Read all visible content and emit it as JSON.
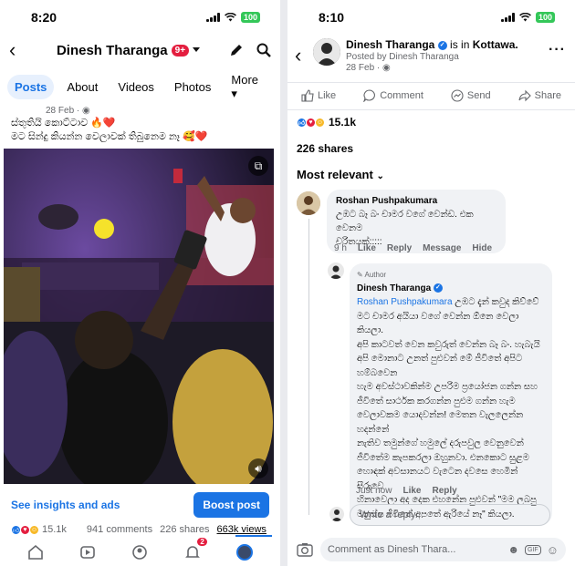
{
  "left": {
    "status": {
      "time": "8:20",
      "battery": "100"
    },
    "header": {
      "title": "Dinesh Tharanga",
      "badge": "9+"
    },
    "tabs": [
      "Posts",
      "About",
      "Videos",
      "Photos",
      "More"
    ],
    "post": {
      "time": "28 Feb · ",
      "line1": "ස්තුතියි කොට්ටාව 🔥❤️",
      "line2": "මට සින්දු කියන්න වෙලාවක් තිබුනෙම නෑ 🥰❤️"
    },
    "insights_link": "See insights and ads",
    "boost_label": "Boost post",
    "stats": {
      "reactions": "15.1k",
      "comments": "941 comments",
      "shares": "226 shares",
      "views": "663k views"
    },
    "nav_notification_badge": "2",
    "colors": {
      "accent": "#1b74e4",
      "badge": "#e41e3f"
    }
  },
  "right": {
    "status": {
      "time": "8:10",
      "battery": "100"
    },
    "header": {
      "name": "Dinesh Tharanga",
      "is_in": "is in",
      "place": "Kottawa.",
      "posted_by": "Posted by Dinesh Tharanga",
      "time": "28 Feb · "
    },
    "actions": [
      "Like",
      "Comment",
      "Send",
      "Share"
    ],
    "reactions": "15.1k",
    "shares": "226 shares",
    "sort": "Most relevant",
    "comment1": {
      "name": "Roshan Pushpakumara",
      "text_l1": "උඹට බෑ බං චාමර වගේ වෙන්ඩ. එක වෙනම",
      "text_l2": "චරිතයක්:::::",
      "time": "9 h",
      "like": "Like",
      "reply": "Reply",
      "message": "Message",
      "hide": "Hide"
    },
    "reply1": {
      "author_tag": "Author",
      "name": "Dinesh Tharanga",
      "mention": "Roshan Pushpakumara",
      "lines": [
        "උඹට දැන් කවුද කිව්වේ",
        "මට චාමර අයියා වගේ වෙන්න ඕනෙ වෙලා කියලා.",
        "අපි කාටවත් වෙන කවුරුත් වෙන්න බෑ බං. හැබැයි",
        "අපි මොනාට උනත් පුළුවන් මේ ජීවිතේ අපිට හම්බවෙන",
        "හැම අවස්ථාවකින්ම උපරිම ප්‍රයෝජන ගන්න සහ",
        "ජීවිතේ සාර්ථක කරගන්න පුළුම ගන්න හැම",
        "වෙලාවකම යොදවන්න! මෙතන වැලලෙන්න හදන්නේ",
        "නැතිව තමුන්ගේ හමුලේ දරුපවුල වෙනුවෙන්",
        "ජීවිතේම කැපකරලා ඔහුනවා. එනකොට සුළම",
        "හොඳක් අවසානයට වැටෙන දවසෙ හෙමින් සීරුවෙ",
        "හිනාවෙලා අද දෙක එහනේන පුළුවන් \"මම ලබපු",
        "මනුස්ස ජීවිතේ අපතේ ඇරියේ නෑ\" කියලා."
      ],
      "time": "Just now",
      "like": "Like",
      "reply": "Reply"
    },
    "reply_placeholder": "Write a reply...",
    "comment_placeholder": "Comment as Dinesh Thara...",
    "gif_label": "GIF"
  }
}
